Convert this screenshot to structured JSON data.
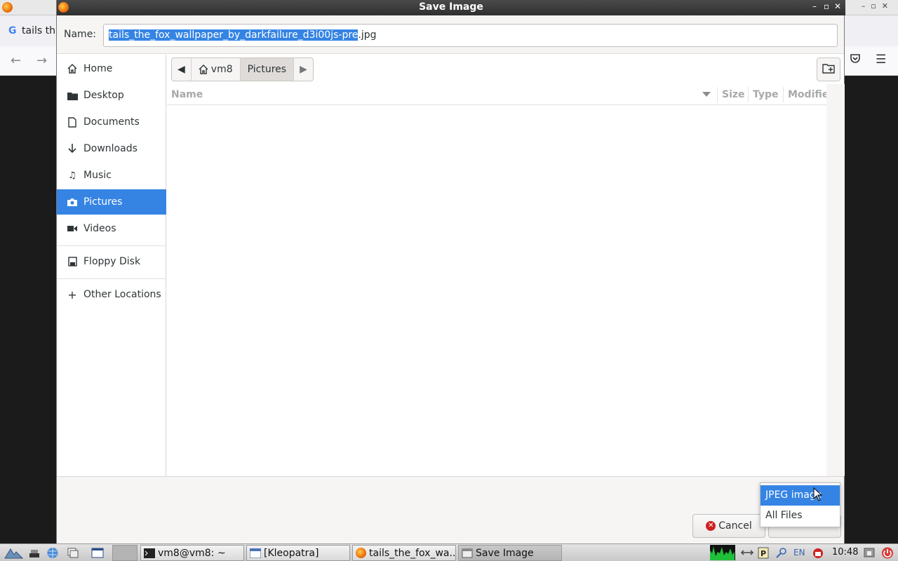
{
  "background_window": {
    "tab_label": "tails th",
    "tab_favicon": "G"
  },
  "dialog": {
    "title": "Save Image",
    "name_label": "Name:",
    "filename_selected": "tails_the_fox_wallpaper_by_darkfailure_d3i00js-pre",
    "filename_ext": ".jpg"
  },
  "sidebar": {
    "items": [
      {
        "label": "Home",
        "icon": "home-icon"
      },
      {
        "label": "Desktop",
        "icon": "folder-icon"
      },
      {
        "label": "Documents",
        "icon": "document-icon"
      },
      {
        "label": "Downloads",
        "icon": "download-icon"
      },
      {
        "label": "Music",
        "icon": "music-icon"
      },
      {
        "label": "Pictures",
        "icon": "camera-icon",
        "active": true
      },
      {
        "label": "Videos",
        "icon": "video-icon"
      },
      {
        "label": "Floppy Disk",
        "icon": "floppy-icon"
      },
      {
        "label": "Other Locations",
        "icon": "plus-icon"
      }
    ]
  },
  "pathbar": {
    "segments": [
      "vm8",
      "Pictures"
    ]
  },
  "filelist": {
    "columns": [
      "Name",
      "Size",
      "Type",
      "Modifie"
    ]
  },
  "footer": {
    "cancel_label": "Cancel",
    "filetype_options": [
      "JPEG image",
      "All Files"
    ],
    "selected_filetype": "JPEG image"
  },
  "taskbar": {
    "tasks": [
      "vm8@vm8: ~",
      "[Kleopatra]",
      "tails_the_fox_wa...",
      "Save Image"
    ],
    "language": "EN",
    "clock": "10:48"
  },
  "colors": {
    "accent": "#3584e4",
    "titlebar": "#2f2f2f"
  }
}
